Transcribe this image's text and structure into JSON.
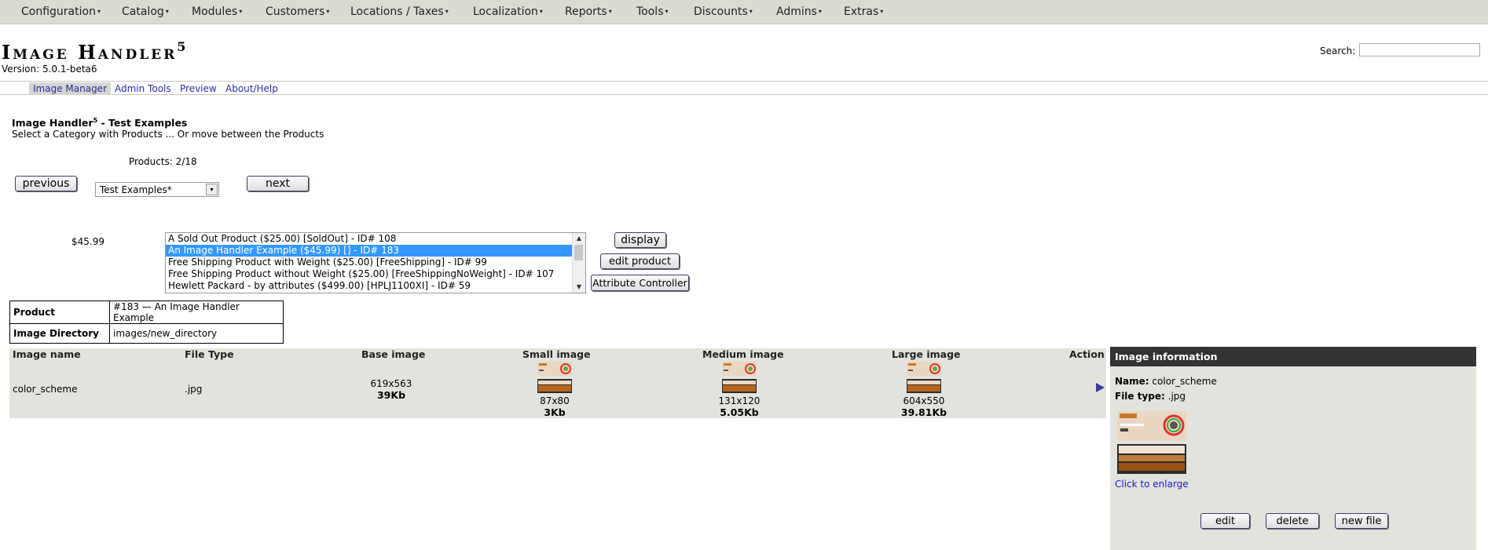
{
  "topnav": [
    {
      "label": "Configuration"
    },
    {
      "label": "Catalog"
    },
    {
      "label": "Modules"
    },
    {
      "label": "Customers"
    },
    {
      "label": "Locations / Taxes"
    },
    {
      "label": "Localization"
    },
    {
      "label": "Reports"
    },
    {
      "label": "Tools"
    },
    {
      "label": "Discounts"
    },
    {
      "label": "Admins"
    },
    {
      "label": "Extras"
    }
  ],
  "caret": "▾",
  "header": {
    "title": "Image Handler",
    "title_sup": "5",
    "version": "Version: 5.0.1-beta6",
    "search_label": "Search:",
    "search_value": ""
  },
  "subnav": [
    {
      "label": "Image Manager"
    },
    {
      "label": "Admin Tools"
    },
    {
      "label": "Preview"
    },
    {
      "label": "About/Help"
    }
  ],
  "section": {
    "title": "Image Handler",
    "title_sup": "5",
    "title_rest": " - Test Examples",
    "subtitle": "Select a Category with Products ... Or move between the Products",
    "products_count": "Products: 2/18"
  },
  "nav": {
    "previous": "previous",
    "next": "next",
    "category": "Test Examples*"
  },
  "price": "$45.99",
  "products": [
    {
      "label": "A Sold Out Product ($25.00) [SoldOut] - ID# 108"
    },
    {
      "label": "An Image Handler Example ($45.99) [] - ID# 183"
    },
    {
      "label": "Free Shipping Product with Weight ($25.00) [FreeShipping] - ID# 99"
    },
    {
      "label": "Free Shipping Product without Weight ($25.00) [FreeShippingNoWeight] - ID# 107"
    },
    {
      "label": "Hewlett Packard - by attributes ($499.00) [HPLJ1100XI] - ID# 59"
    }
  ],
  "selected_product_index": 1,
  "actions": {
    "display": "display",
    "edit_product": "edit product",
    "attribute_controller": "Attribute Controller"
  },
  "product_info": {
    "product_label": "Product",
    "product_value": "#183 — An Image Handler Example",
    "dir_label": "Image Directory",
    "dir_value": "images/new_directory"
  },
  "image_table": {
    "headers": {
      "name": "Image name",
      "type": "File Type",
      "base": "Base image",
      "small": "Small image",
      "medium": "Medium image",
      "large": "Large image",
      "action": "Action"
    },
    "row": {
      "name": "color_scheme",
      "type": ".jpg",
      "base_dim": "619x563",
      "base_size": "39Kb",
      "small_dim": "87x80",
      "small_size": "3Kb",
      "medium_dim": "131x120",
      "medium_size": "5.05Kb",
      "large_dim": "604x550",
      "large_size": "39.81Kb"
    }
  },
  "image_info": {
    "title": "Image information",
    "name_label": "Name:",
    "name_value": "color_scheme",
    "type_label": "File type:",
    "type_value": ".jpg",
    "enlarge": "Click to enlarge",
    "edit": "edit",
    "delete": "delete",
    "new_file": "new file"
  },
  "colors": {
    "menu_bg": "#dbdbd3",
    "panel_bg": "#e3e3dd",
    "panel_title_bg": "#333333",
    "link": "#2a2aa8",
    "selection": "#3399ff",
    "orange": "#c8782a"
  }
}
